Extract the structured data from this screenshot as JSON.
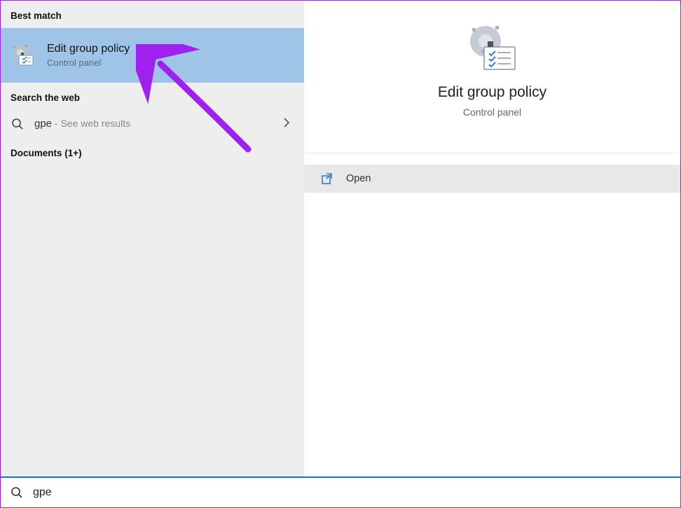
{
  "left": {
    "best_match_header": "Best match",
    "best_match": {
      "title": "Edit group policy",
      "subtitle": "Control panel"
    },
    "search_web_header": "Search the web",
    "web_result": {
      "query": "gpe",
      "hint": " - See web results"
    },
    "documents_header": "Documents (1+)"
  },
  "right": {
    "preview_title": "Edit group policy",
    "preview_subtitle": "Control panel",
    "action_open": "Open"
  },
  "search": {
    "value": "gpe"
  }
}
